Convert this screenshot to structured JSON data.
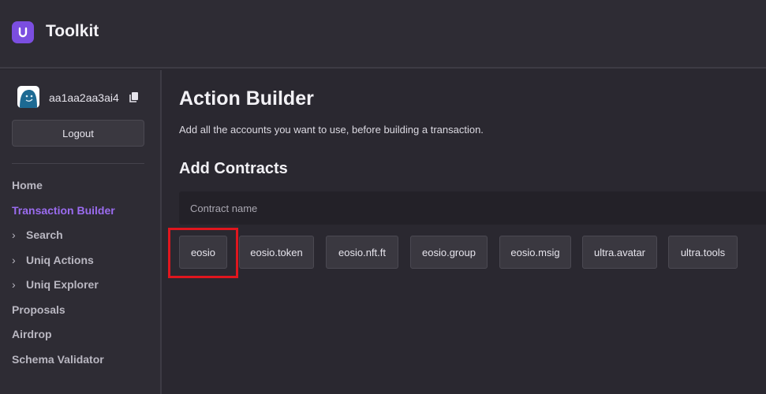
{
  "app": {
    "title": "Toolkit",
    "logo_icon": "ultra-logo-icon",
    "accent": "#7b4ee0"
  },
  "user": {
    "name": "aa1aa2aa3ai4",
    "logout_label": "Logout"
  },
  "nav": {
    "items": [
      {
        "label": "Home",
        "expandable": false,
        "active": false
      },
      {
        "label": "Transaction Builder",
        "expandable": false,
        "active": true
      },
      {
        "label": "Search",
        "expandable": true,
        "active": false
      },
      {
        "label": "Uniq Actions",
        "expandable": true,
        "active": false
      },
      {
        "label": "Uniq Explorer",
        "expandable": true,
        "active": false
      },
      {
        "label": "Proposals",
        "expandable": false,
        "active": false
      },
      {
        "label": "Airdrop",
        "expandable": false,
        "active": false
      },
      {
        "label": "Schema Validator",
        "expandable": false,
        "active": false
      }
    ],
    "chevron": "›",
    "active_color": "#9b6cf0"
  },
  "main": {
    "title": "Action Builder",
    "subtitle": "Add all the accounts you want to use, before building a transaction.",
    "section_title": "Add Contracts",
    "contract_input_placeholder": "Contract name",
    "contracts": [
      "eosio",
      "eosio.token",
      "eosio.nft.ft",
      "eosio.group",
      "eosio.msig",
      "ultra.avatar",
      "ultra.tools"
    ],
    "highlighted_contract": "eosio",
    "highlight_color": "#e0161e"
  }
}
